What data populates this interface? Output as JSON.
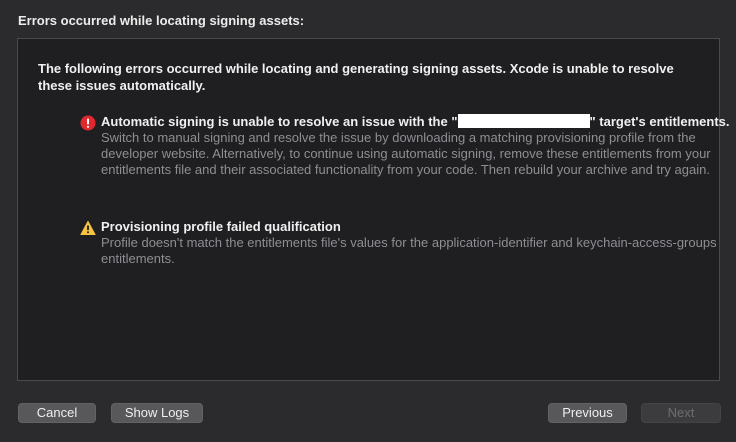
{
  "dialog": {
    "title": "Errors occurred while locating signing assets:",
    "intro": "The following errors occurred while locating and generating signing assets. Xcode is unable to resolve these issues automatically.",
    "errors": [
      {
        "icon": "error-icon",
        "title_prefix": "Automatic signing is unable to resolve an issue with the \"",
        "title_suffix": "\" target's entitlements.",
        "description": "Switch to manual signing and resolve the issue by downloading a matching provisioning profile from the developer website. Alternatively, to continue using automatic signing, remove these entitlements from your entitlements file and their associated functionality from your code. Then rebuild your archive and try again."
      },
      {
        "icon": "warning-icon",
        "title": "Provisioning profile failed qualification",
        "description": "Profile doesn't match the entitlements file's values for the application-identifier and keychain-access-groups entitlements."
      }
    ]
  },
  "buttons": {
    "cancel": "Cancel",
    "show_logs": "Show Logs",
    "previous": "Previous",
    "next": "Next"
  },
  "colors": {
    "error_icon": "#e0282e",
    "warning_icon": "#f5c242",
    "redaction": "#ffffff"
  }
}
